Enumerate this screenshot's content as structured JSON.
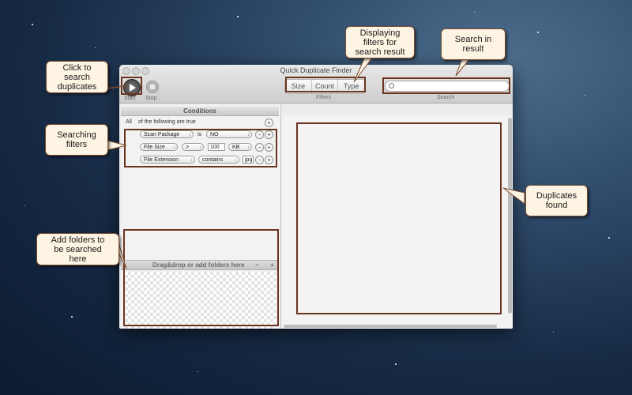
{
  "window": {
    "title": "Quick Duplicate Finder"
  },
  "toolbar": {
    "start_label": "Start",
    "stop_label": "Stop",
    "filters_label": "Filters",
    "search_label": "Search",
    "filter_tabs": [
      "Size",
      "Count",
      "Type"
    ],
    "search_placeholder": ""
  },
  "conditions": {
    "header": "Conditions",
    "match_all": "All",
    "match_suffix": "of the following are true",
    "rows": [
      {
        "attribute": "Scan Package",
        "operator": "is",
        "value": "NO"
      },
      {
        "attribute": "File Size",
        "operator": ">",
        "value": "100",
        "unit": "KB"
      },
      {
        "attribute": "File Extension",
        "operator": "contains",
        "value": "jpg"
      }
    ]
  },
  "folders": {
    "header": "Drag&drop or add folders here",
    "minus": "−",
    "plus": "+"
  },
  "callouts": {
    "start": "Click to\nsearch\nduplicates",
    "filters_display": "Displaying\nfilters for\nsearch result",
    "search": "Search in\nresult",
    "search_filters": "Searching\nfilters",
    "duplicates": "Duplicates\nfound",
    "folders": "Add folders to\nbe searched\nhere"
  },
  "icons": {
    "start": "play-icon",
    "stop": "stop-icon",
    "search": "magnifier-icon"
  },
  "colors": {
    "highlight": "#6a3421",
    "callout_bg": "#fdf4e3"
  }
}
